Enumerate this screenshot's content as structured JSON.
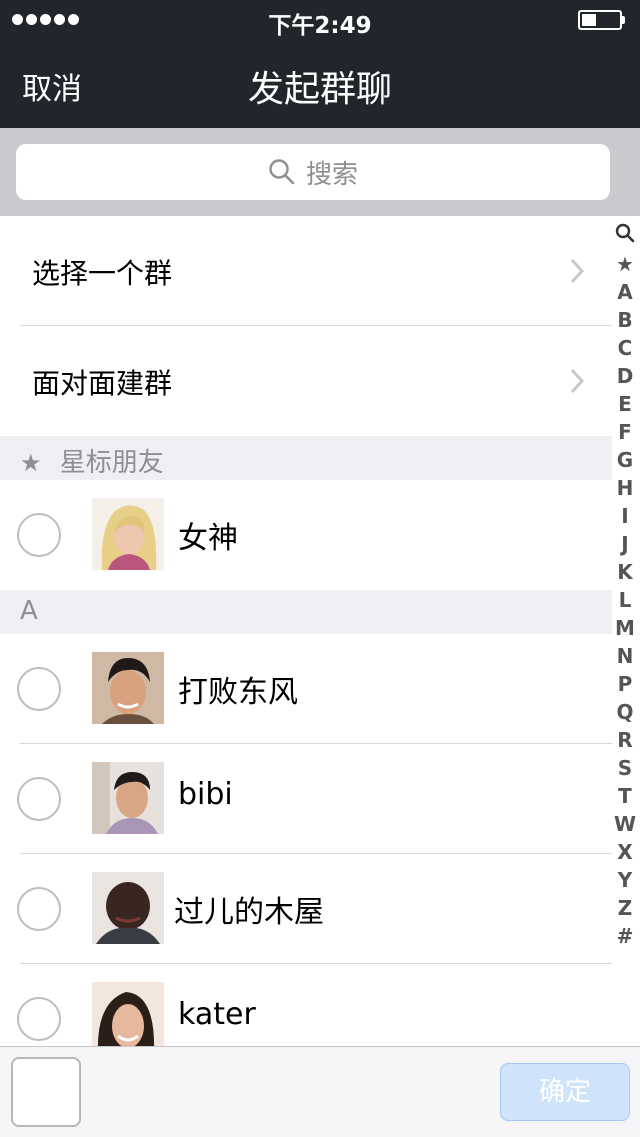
{
  "status_bar": {
    "time": "下午2:49"
  },
  "nav": {
    "cancel_label": "取消",
    "title": "发起群聊"
  },
  "search": {
    "placeholder": "搜索"
  },
  "options": [
    {
      "label": "选择一个群"
    },
    {
      "label": "面对面建群"
    }
  ],
  "sections": {
    "starred": {
      "label": "星标朋友",
      "icon": "star-icon"
    },
    "a": {
      "label": "A"
    }
  },
  "contacts": [
    {
      "name": "女神"
    },
    {
      "name": "打败东风"
    },
    {
      "name": "bibi"
    },
    {
      "name": "过儿的木屋"
    },
    {
      "name": "kater"
    }
  ],
  "index": [
    "★",
    "A",
    "B",
    "C",
    "D",
    "E",
    "F",
    "G",
    "H",
    "I",
    "J",
    "K",
    "L",
    "M",
    "N",
    "P",
    "Q",
    "R",
    "S",
    "T",
    "W",
    "X",
    "Y",
    "Z",
    "#"
  ],
  "bottom": {
    "confirm_label": "确定"
  },
  "colors": {
    "header_bg": "#20262b",
    "search_bg": "#c9c9ce",
    "section_bg": "#eeeef3",
    "confirm_bg": "#cfe3fb"
  }
}
